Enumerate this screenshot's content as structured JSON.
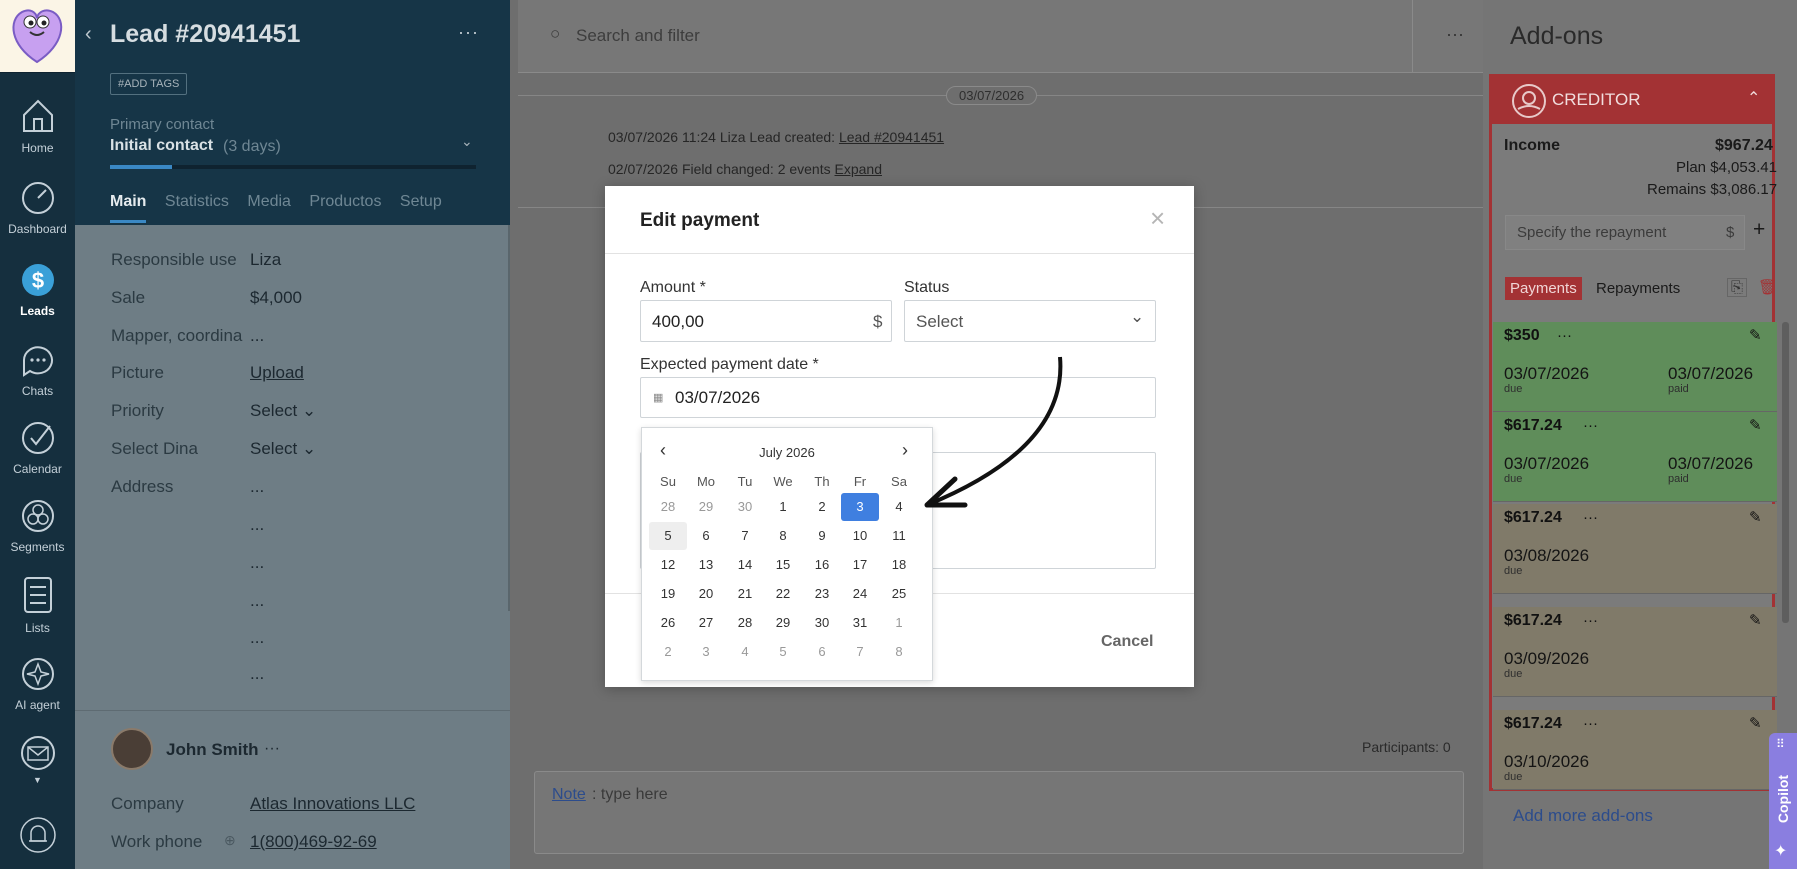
{
  "nav": {
    "items": [
      {
        "label": "Home",
        "icon": "house-icon"
      },
      {
        "label": "Dashboard",
        "icon": "speedometer-icon"
      },
      {
        "label": "Leads",
        "icon": "dollar-icon"
      },
      {
        "label": "Chats",
        "icon": "chat-icon"
      },
      {
        "label": "Calendar",
        "icon": "check-circle-icon"
      },
      {
        "label": "Segments",
        "icon": "segments-icon"
      },
      {
        "label": "Lists",
        "icon": "list-icon"
      },
      {
        "label": "AI agent",
        "icon": "sparkle-icon"
      }
    ]
  },
  "lead": {
    "title": "Lead #20941451",
    "add_tags": "#ADD TAGS",
    "primary_contact_label": "Primary contact",
    "stage": "Initial contact",
    "stage_duration": "(3 days)",
    "tabs": [
      "Main",
      "Statistics",
      "Media",
      "Productos",
      "Setup"
    ],
    "fields": [
      {
        "label": "Responsible use",
        "value": "Liza"
      },
      {
        "label": "Sale",
        "value": "$4,000"
      },
      {
        "label": "Mapper, coordina",
        "value": "..."
      },
      {
        "label": "Picture",
        "value": "Upload"
      },
      {
        "label": "Priority",
        "value": "Select"
      },
      {
        "label": "Select Dina",
        "value": "Select"
      },
      {
        "label": "Address",
        "value": "..."
      }
    ],
    "address_lines": [
      "...",
      "...",
      "...",
      "...",
      "..."
    ],
    "contact": {
      "name": "John Smith",
      "more": "···",
      "company_label": "Company",
      "company_value": "Atlas Innovations LLC",
      "phone_label": "Work phone",
      "phone_value": "1(800)469-92-69"
    }
  },
  "feed": {
    "search_placeholder": "Search and filter",
    "more": "···",
    "date_chip": "03/07/2026",
    "events": [
      {
        "prefix": "03/07/2026 11:24 Liza Lead created: ",
        "link": "Lead #20941451"
      },
      {
        "prefix": "02/07/2026 Field changed: 2 events ",
        "link": "Expand"
      }
    ],
    "participants": "Participants: 0",
    "note_link": "Note",
    "note_placeholder": ": type here"
  },
  "modal": {
    "title": "Edit payment",
    "close": "×",
    "amount_label": "Amount *",
    "amount_value": "400,00",
    "currency": "$",
    "status_label": "Status",
    "status_value": "Select",
    "date_label": "Expected payment date *",
    "date_value": "03/07/2026",
    "cancel": "Cancel"
  },
  "calendar": {
    "month": "July 2026",
    "dow": [
      "Su",
      "Mo",
      "Tu",
      "We",
      "Th",
      "Fr",
      "Sa"
    ],
    "weeks": [
      [
        "28",
        "29",
        "30",
        "1",
        "2",
        "3",
        "4"
      ],
      [
        "5",
        "6",
        "7",
        "8",
        "9",
        "10",
        "11"
      ],
      [
        "12",
        "13",
        "14",
        "15",
        "16",
        "17",
        "18"
      ],
      [
        "19",
        "20",
        "21",
        "22",
        "23",
        "24",
        "25"
      ],
      [
        "26",
        "27",
        "28",
        "29",
        "30",
        "31",
        "1"
      ],
      [
        "2",
        "3",
        "4",
        "5",
        "6",
        "7",
        "8"
      ]
    ],
    "selected": "3"
  },
  "addons": {
    "title": "Add-ons",
    "widget_name": "CREDITOR",
    "income_label": "Income",
    "income_value": "$967.24",
    "plan": "Plan $4,053.41",
    "remains": "Remains $3,086.17",
    "repay_placeholder": "Specify the repayment",
    "currency": "$",
    "tabs": [
      "Payments",
      "Repayments"
    ],
    "payments": [
      {
        "amount": "$350",
        "due": "03/07/2026",
        "paid": "03/07/2026",
        "status": "paid"
      },
      {
        "amount": "$617.24",
        "due": "03/07/2026",
        "paid": "03/07/2026",
        "status": "paid"
      },
      {
        "amount": "$617.24",
        "due": "03/08/2026",
        "paid": "",
        "status": "due"
      },
      {
        "amount": "$617.24",
        "due": "03/09/2026",
        "paid": "",
        "status": "due"
      },
      {
        "amount": "$617.24",
        "due": "03/10/2026",
        "paid": "",
        "status": "due"
      }
    ],
    "due_label": "due",
    "paid_label": "paid",
    "more": "···",
    "add_more": "Add more add-ons",
    "copilot": "Copilot",
    "colors": {
      "accent": "#c0393b",
      "paid_bg": "#5f8d5a",
      "due_bg": "#807a69"
    }
  }
}
